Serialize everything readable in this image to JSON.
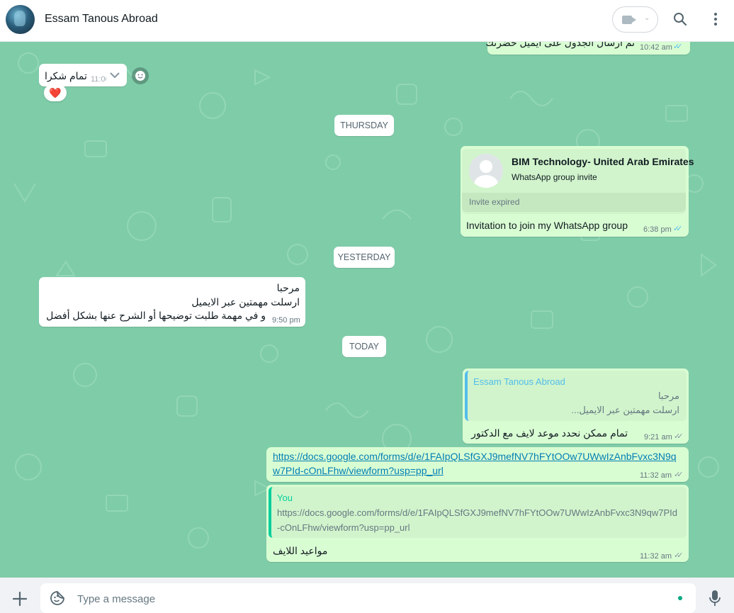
{
  "header": {
    "contact_name": "Essam Tanous Abroad",
    "video_icon": "video-camera-icon",
    "chevron_icon": "chevron-down-icon",
    "search_icon": "search-icon",
    "menu_icon": "kebab-menu-icon"
  },
  "messages": {
    "top_out": {
      "text": "تم ارسال الجدول على ايميل حضرتك",
      "time": "10:42 am"
    },
    "in_thanks": {
      "text": "تمام شكرا",
      "time": "11:06",
      "reaction": "❤️"
    },
    "date1": "THURSDAY",
    "invite": {
      "group_name": "BIM Technology- United Arab Emirates",
      "subtitle": "WhatsApp group invite",
      "status": "Invite expired",
      "caption": "Invitation to join my WhatsApp group",
      "time": "6:38 pm"
    },
    "date2": "YESTERDAY",
    "in_long": {
      "line1": "مرحبا",
      "line2": "ارسلت مهمتين عبر الايميل",
      "line3": "و في مهمة طلبت توضيحها أو الشرح عنها بشكل أفضل",
      "time": "9:50 pm"
    },
    "date3": "TODAY",
    "reply1": {
      "quote_author": "Essam Tanous Abroad",
      "quote_line1": "مرحبا",
      "quote_line2": "ارسلت مهمتين عبر الايميل...",
      "text": "تمام ممكن نحدد موعد لايف مع الدكتور",
      "time": "9:21 am"
    },
    "link_msg": {
      "line1": "https://docs.google.com/forms/d/e/1FAIpQLSfGXJ9mefNV7hFYtOOw7UWwIzAnbFvxc3N9q",
      "line2": "w7PId-cOnLFhw/viewform?usp=pp_url",
      "time": "11:32 am"
    },
    "reply2": {
      "quote_author": "You",
      "quote_line1": "https://docs.google.com/forms/d/e/1FAIpQLSfGXJ9mefNV7hFYtOOw7UWwIzAnbFvxc3N9qw7PId",
      "quote_line2": "-cOnLFhw/viewform?usp=pp_url",
      "text": "مواعيد اللايف",
      "time": "11:32 am"
    }
  },
  "composer": {
    "placeholder": "Type a message",
    "attach_icon": "plus-icon",
    "sticker_icon": "sticker-icon",
    "mic_icon": "microphone-icon"
  },
  "colors": {
    "chat_bg": "#7fcca8",
    "outgoing_bubble": "#d9fdd3",
    "incoming_bubble": "#ffffff",
    "read_ticks": "#53bdeb"
  }
}
